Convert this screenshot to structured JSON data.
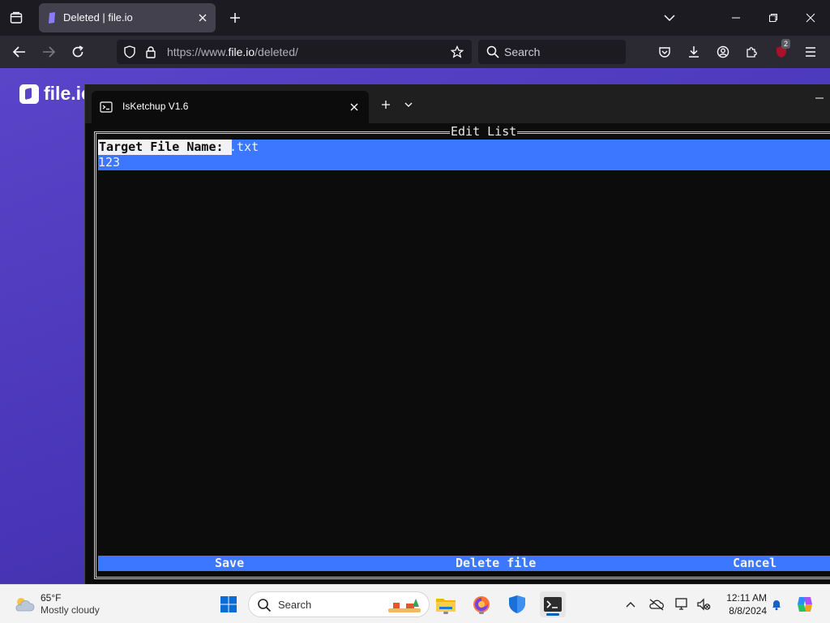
{
  "browser": {
    "tab": {
      "title": "Deleted | file.io"
    },
    "url": {
      "prefix": "https://www.",
      "host": "file.io",
      "path": "/deleted/"
    },
    "search": {
      "placeholder": "Search"
    },
    "extension_badge": "2"
  },
  "page": {
    "logo_text": "file.io"
  },
  "terminal": {
    "tab_title": "IsKetchup V1.6",
    "frame_title": "Edit List",
    "target_label": "Target File Name: ",
    "target_name": ".txt",
    "value_line": "123",
    "actions": {
      "save": "Save",
      "delete": "Delete file",
      "cancel": "Cancel"
    }
  },
  "taskbar": {
    "weather": {
      "temp": "65°F",
      "condition": "Mostly cloudy"
    },
    "search_placeholder": "Search",
    "clock": {
      "time": "12:11 AM",
      "date": "8/8/2024"
    }
  },
  "colors": {
    "selection": "#3b78ff",
    "terminal_bg": "#0c0c0c",
    "page_accent": "#5a44c9"
  }
}
